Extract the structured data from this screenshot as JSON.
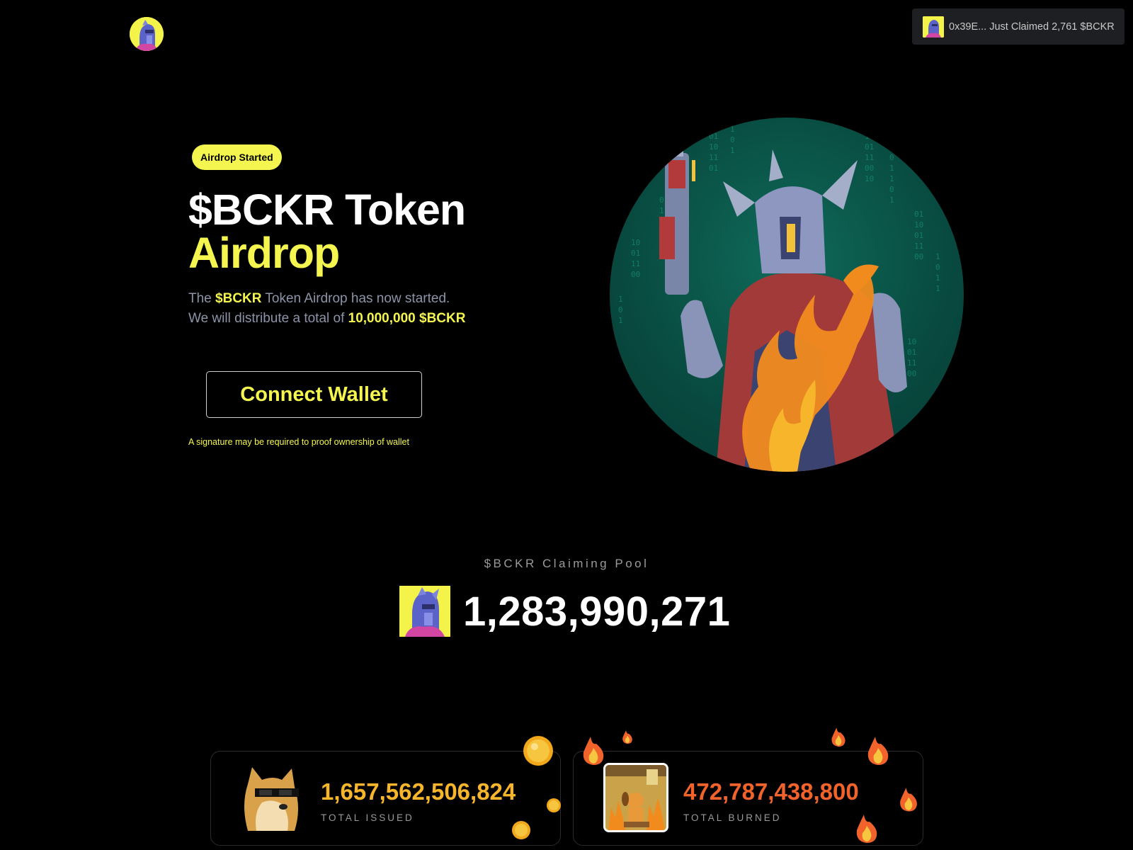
{
  "header": {
    "logo_icon": "bckr-knight-avatar-icon"
  },
  "toast": {
    "text": "0x39E... Just Claimed 2,761 $BCKR",
    "avatar_icon": "bckr-knight-avatar-icon"
  },
  "hero": {
    "badge": "Airdrop Started",
    "title_line1": "$BCKR Token",
    "title_line2": "Airdrop",
    "desc_prefix": "The ",
    "desc_token": "$BCKR",
    "desc_middle": " Token Airdrop has now started.",
    "desc_line2_prefix": "We will distribute a total of ",
    "desc_amount": "10,000,000 $BCKR",
    "connect_button": "Connect Wallet",
    "signature_note": "A signature may be required to proof ownership of wallet",
    "image_icon": "armored-knight-with-gun-illustration"
  },
  "pool": {
    "label": "$BCKR Claiming Pool",
    "value": "1,283,990,271",
    "icon": "bckr-knight-avatar-icon"
  },
  "stats": {
    "issued": {
      "value": "1,657,562,506,824",
      "label": "TOTAL ISSUED",
      "icon": "doge-sunglasses-icon",
      "deco_icon": "gold-coin-icon"
    },
    "burned": {
      "value": "472,787,438,800",
      "label": "TOTAL BURNED",
      "icon": "this-is-fine-dog-icon",
      "deco_icon": "fire-icon"
    }
  },
  "colors": {
    "accent": "#f4f54e",
    "issued": "#f7b52b",
    "burned": "#f2632c",
    "muted": "#8d93a8"
  }
}
